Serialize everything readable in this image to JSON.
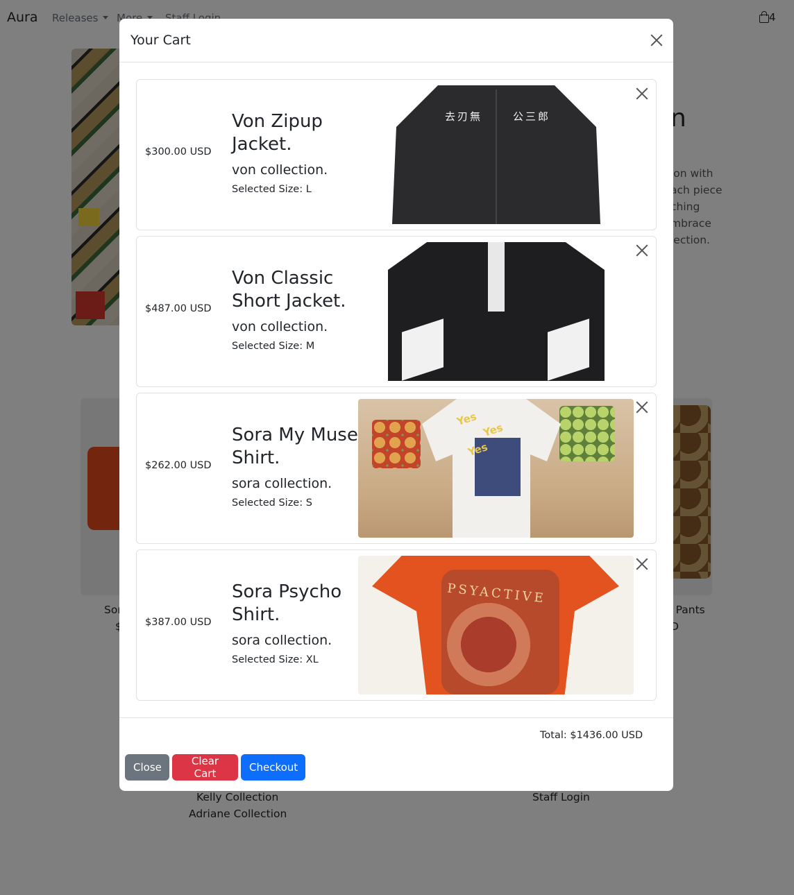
{
  "navbar": {
    "brand": "Aura",
    "items": [
      "Releases",
      "More",
      "Staff Login"
    ],
    "cart_count": "4"
  },
  "background": {
    "hero_title_fragment": "n",
    "hero_text_fragments": [
      "ion with",
      "ach piece",
      "ching",
      "mbrace",
      "lection."
    ],
    "product_left_caption": [
      "Sor",
      "$"
    ],
    "product_right_caption": [
      "w Pants",
      "D"
    ],
    "footer_links_left": [
      "Kelly Collection",
      "Adriane Collection"
    ],
    "footer_links_right": [
      "Staff Login"
    ]
  },
  "modal": {
    "title": "Your Cart",
    "items": [
      {
        "price": "$300.00 USD",
        "name": "Von Zipup Jacket.",
        "collection": "von collection.",
        "size": "Selected Size: L",
        "image": "black zipup jacket"
      },
      {
        "price": "$487.00 USD",
        "name": "Von Classic Short Jacket.",
        "collection": "von collection.",
        "size": "Selected Size: M",
        "image": "black classic short jacket"
      },
      {
        "price": "$262.00 USD",
        "name": "Sora My Muse Shirt.",
        "collection": "sora collection.",
        "size": "Selected Size: S",
        "image": "printed white shirt"
      },
      {
        "price": "$387.00 USD",
        "name": "Sora Psycho Shirt.",
        "collection": "sora collection.",
        "size": "Selected Size: XL",
        "image": "orange printed shirt"
      }
    ],
    "image_text": {
      "jacket_kanji_left": "去刃無",
      "jacket_kanji_right": "公三郎",
      "shirt1_yes": "Yes",
      "shirt2_print": "PSYACTIVE"
    },
    "total": "Total: $1436.00 USD",
    "buttons": {
      "close": "Close",
      "clear": "Clear Cart",
      "checkout": "Checkout"
    }
  },
  "colors": {
    "backdrop": "rgba(0,0,0,0.5)",
    "close_button": "#6c757d",
    "clear_button": "#dc3545",
    "checkout_button": "#0d6efd"
  },
  "icons": [
    "close-icon",
    "shopping-bag-icon",
    "dropdown-caret-icon"
  ]
}
